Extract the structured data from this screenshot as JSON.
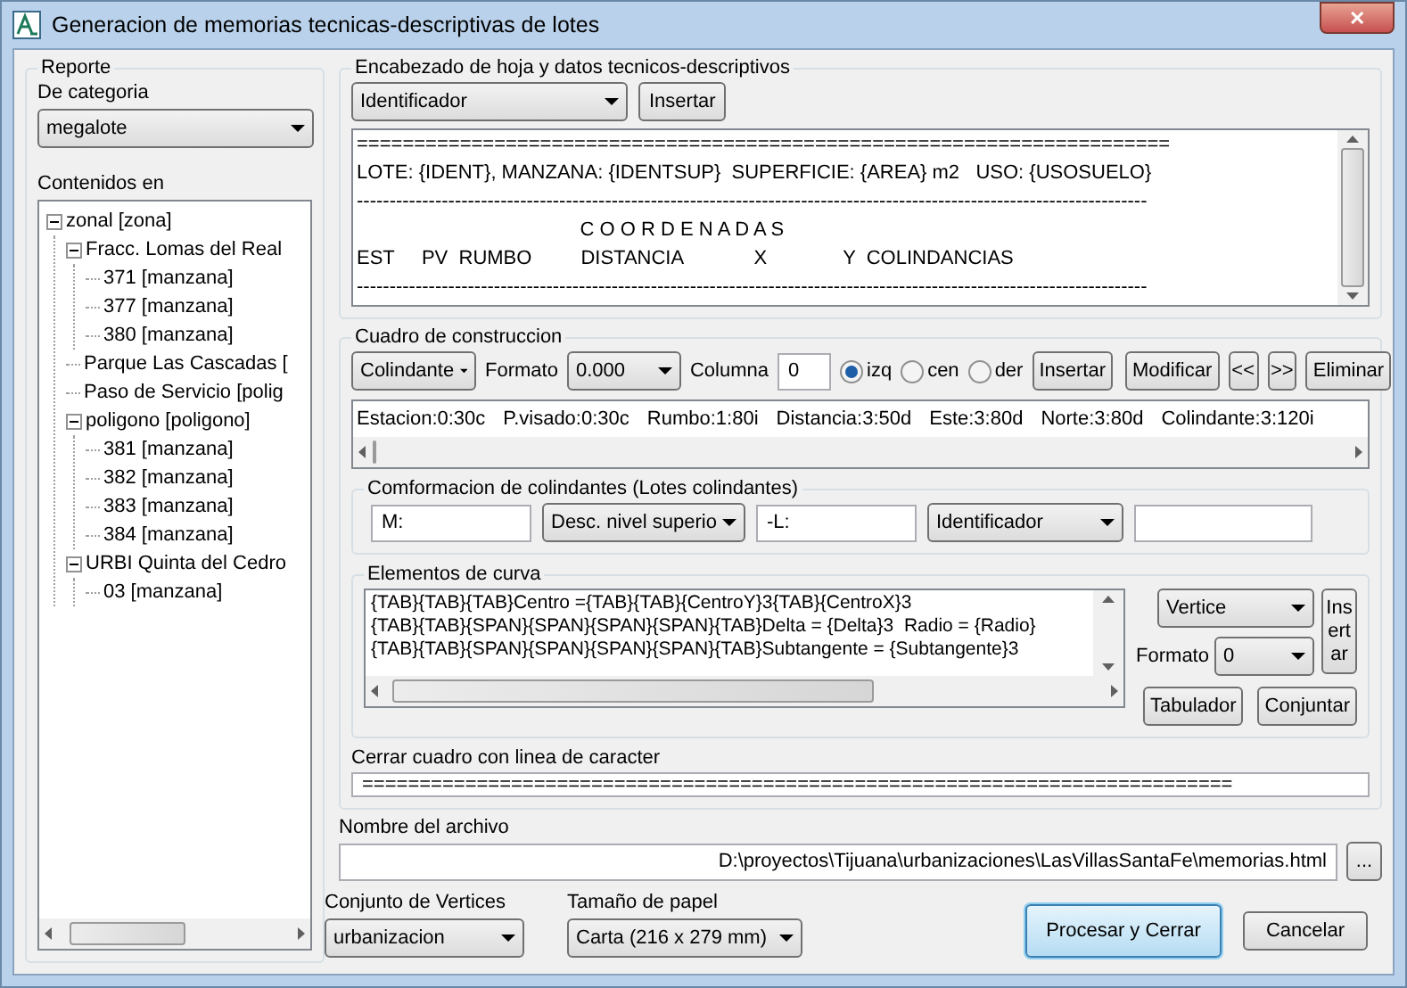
{
  "window": {
    "title": "Generacion de memorias tecnicas-descriptivas de lotes",
    "close_label": "✕"
  },
  "reporte": {
    "title": "Reporte",
    "categoria_label": "De categoria",
    "categoria_value": "megalote",
    "contenidos_label": "Contenidos en",
    "tree": [
      {
        "label": "zonal [zona]",
        "expanded": true,
        "children": [
          {
            "label": "Fracc. Lomas del Real",
            "expanded": true,
            "children": [
              {
                "label": "371 [manzana]"
              },
              {
                "label": "377 [manzana]"
              },
              {
                "label": "380 [manzana]"
              }
            ]
          },
          {
            "label": "Parque Las Cascadas ["
          },
          {
            "label": "Paso de Servicio [polig"
          },
          {
            "label": "poligono [poligono]",
            "expanded": true,
            "children": [
              {
                "label": "381 [manzana]"
              },
              {
                "label": "382 [manzana]"
              },
              {
                "label": "383 [manzana]"
              },
              {
                "label": "384 [manzana]"
              }
            ]
          },
          {
            "label": "URBI Quinta del Cedro",
            "expanded": true,
            "children": [
              {
                "label": "03 [manzana]"
              }
            ]
          }
        ]
      }
    ]
  },
  "encabezado": {
    "title": "Encabezado de hoja y datos tecnicos-descriptivos",
    "dropdown": "Identificador",
    "insert_button": "Insertar",
    "lines": [
      "=======================================================================",
      "LOTE: {IDENT}, MANZANA: {IDENTSUP}  SUPERFICIE: {AREA} m2   USO: {USOSUELO}",
      "-------------------------------------------------------------------------------------------------------------------------",
      "                                         C O O R D E N A D A S",
      "EST     PV  RUMBO         DISTANCIA             X              Y  COLINDANCIAS",
      "-------------------------------------------------------------------------------------------------------------------------"
    ]
  },
  "cuadro": {
    "title": "Cuadro de construccion",
    "dropdown": "Colindante",
    "formato_label": "Formato",
    "formato_value": "0.000",
    "columna_label": "Columna",
    "columna_value": "0",
    "alignments": [
      {
        "label": "izq",
        "selected": true
      },
      {
        "label": "cen",
        "selected": false
      },
      {
        "label": "der",
        "selected": false
      }
    ],
    "buttons": [
      "Insertar",
      "Modificar",
      "<<",
      ">>",
      "Eliminar"
    ],
    "columns": [
      "Estacion:0:30c",
      "P.visado:0:30c",
      "Rumbo:1:80i",
      "Distancia:3:50d",
      "Este:3:80d",
      "Norte:3:80d",
      "Colindante:3:120i"
    ]
  },
  "colindantes": {
    "title": "Comformacion de colindantes (Lotes colindantes)",
    "fields": [
      {
        "kind": "input",
        "value": "M:"
      },
      {
        "kind": "select",
        "value": "Desc. nivel superio"
      },
      {
        "kind": "input",
        "value": "-L:"
      },
      {
        "kind": "select",
        "value": "Identificador"
      },
      {
        "kind": "input"
      }
    ]
  },
  "curva": {
    "title": "Elementos de curva",
    "lines": [
      "{TAB}{TAB}{TAB}Centro ={TAB}{TAB}{CentroY}3{TAB}{CentroX}3",
      "{TAB}{TAB}{SPAN}{SPAN}{SPAN}{SPAN}{TAB}Delta = {Delta}3  Radio = {Radio}",
      "{TAB}{TAB}{SPAN}{SPAN}{SPAN}{SPAN}{TAB}Subtangente = {Subtangente}3"
    ],
    "dropdown": "Vertice",
    "insert_button": "Insertar",
    "formato_label": "Formato",
    "formato_value": "0",
    "buttons": [
      "Tabulador",
      "Conjuntar"
    ]
  },
  "cierre": {
    "label": "Cerrar cuadro con linea de caracter",
    "value": "============================================================================"
  },
  "archivo": {
    "label": "Nombre del archivo",
    "value": "D:\\proyectos\\Tijuana\\urbanizaciones\\LasVillasSantaFe\\memorias.html",
    "browse_button": "..."
  },
  "vertices": {
    "label": "Conjunto de Vertices",
    "value": "urbanizacion"
  },
  "papel": {
    "label": "Tamaño de papel",
    "value": "Carta (216 x 279 mm)"
  },
  "actions": [
    {
      "label": "Procesar y Cerrar",
      "default": true
    },
    {
      "label": "Cancelar",
      "default": false
    }
  ]
}
